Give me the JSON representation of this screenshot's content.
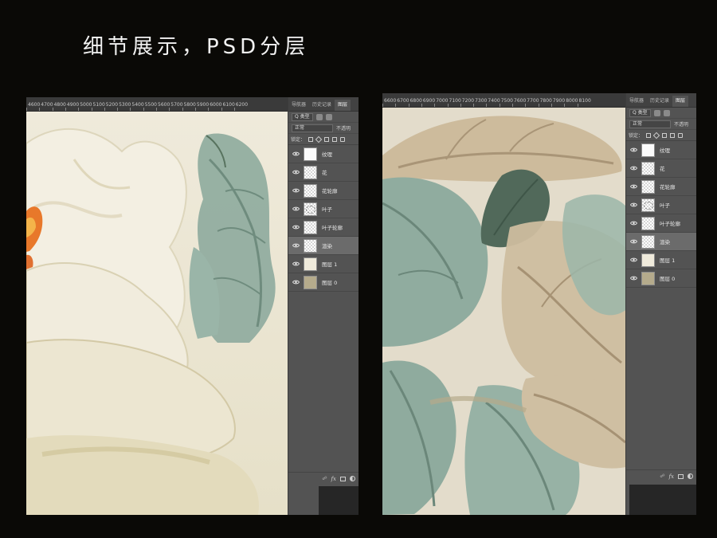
{
  "headline": "细节展示，PSD分层",
  "panel_tabs": [
    "导航器",
    "历史记录",
    "图层"
  ],
  "filter": {
    "label": "Q 类型"
  },
  "blend_mode": {
    "value": "正常"
  },
  "opacity_label": "不透明",
  "lock_label": "锁定：",
  "layers": [
    {
      "name": "纹理",
      "thumb": "white",
      "selected": false
    },
    {
      "name": "花",
      "thumb": "checker",
      "selected": false
    },
    {
      "name": "花轮廓",
      "thumb": "checker",
      "selected": false
    },
    {
      "name": "叶子",
      "thumb": "sketch",
      "selected": false
    },
    {
      "name": "叶子轮廓",
      "thumb": "checker",
      "selected": false
    },
    {
      "name": "渲染",
      "thumb": "checker",
      "selected": true
    },
    {
      "name": "图层 1",
      "thumb": "cream",
      "selected": false
    },
    {
      "name": "图层 0",
      "thumb": "tan",
      "selected": false
    }
  ],
  "footer_icons": [
    "link-icon",
    "fx-icon",
    "mask-icon",
    "adjustment-icon"
  ],
  "footer_fx": "fx",
  "ruler_left": [
    "4600",
    "4700",
    "4800",
    "4900",
    "5000",
    "5100",
    "5200",
    "5300",
    "5400",
    "5500",
    "5600",
    "5700",
    "5800",
    "5900",
    "6000",
    "6100",
    "6200"
  ],
  "ruler_right": [
    "6600",
    "6700",
    "6800",
    "6900",
    "7000",
    "7100",
    "7200",
    "7300",
    "7400",
    "7500",
    "7600",
    "7700",
    "7800",
    "7900",
    "8000",
    "8100"
  ],
  "colors": {
    "panel_bg": "#535353",
    "selected_row": "#6b6b6b",
    "canvas_cream": "#ede8d8",
    "leaf_green": "#8aa79a",
    "leaf_dark": "#51695a",
    "leaf_tan": "#c8b496",
    "flower_orange": "#e8782a"
  }
}
